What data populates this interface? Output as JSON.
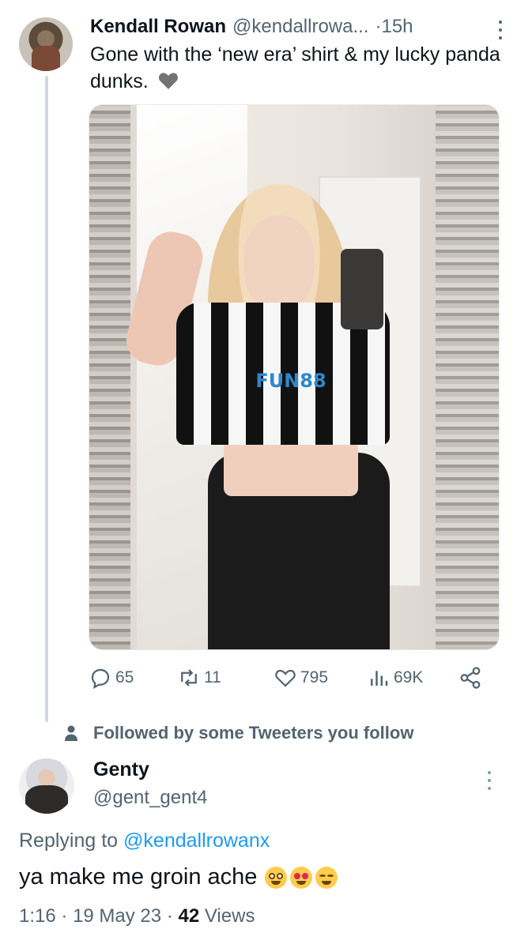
{
  "colors": {
    "accent": "#1d9bf0",
    "secondary_text": "#536471",
    "primary_text": "#0f1419",
    "thread_line": "#cfd9de"
  },
  "tweet": {
    "author_name": "Kendall Rowan",
    "author_handle": "@kendallrowa...",
    "separator": "·",
    "time": "15h",
    "text": "Gone with the ‘new era’ shirt & my lucky panda dunks.",
    "text_emoji_icon": "grey-heart-icon",
    "photo_shirt_text": "FUN88",
    "stats": {
      "replies": "65",
      "retweets": "11",
      "likes": "795",
      "views": "69K"
    }
  },
  "followed_notice": {
    "icon": "person-icon",
    "label": "Followed by some Tweeters you follow"
  },
  "reply": {
    "author_name": "Genty",
    "author_handle": "@gent_gent4",
    "replying_prefix": "Replying to",
    "replying_mention": "@kendallrowanx",
    "text": "ya make me groin ache",
    "emojis": [
      "flushed-face-emoji",
      "heart-eyes-emoji",
      "grinning-sweat-emoji"
    ],
    "time": "1:16",
    "date": "19 May 23",
    "separator": "·",
    "views_count": "42",
    "views_label": "Views"
  }
}
